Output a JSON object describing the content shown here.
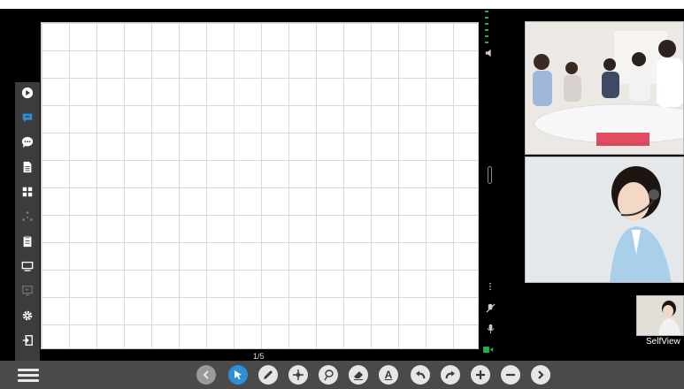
{
  "whiteboard": {
    "page_indicator": "1/5"
  },
  "left_toolbar": {
    "items": [
      {
        "icon": "play-circle-icon"
      },
      {
        "icon": "chat-bubble-icon",
        "active": true
      },
      {
        "icon": "message-dots-icon"
      },
      {
        "icon": "document-icon"
      },
      {
        "icon": "grid-icon"
      },
      {
        "icon": "share-nodes-icon"
      },
      {
        "icon": "clipboard-icon"
      },
      {
        "icon": "monitor-icon"
      },
      {
        "icon": "screen-share-icon"
      },
      {
        "icon": "settings-gear-icon"
      },
      {
        "icon": "exit-icon"
      }
    ]
  },
  "video_panel": {
    "self_view_label": "SelfView"
  },
  "bottom_toolbar": {
    "tools": [
      {
        "name": "previous-page",
        "icon": "chevron-left-icon",
        "disabled": true
      },
      {
        "name": "select",
        "icon": "cursor-arrow-icon",
        "active": true
      },
      {
        "name": "pen",
        "icon": "pen-icon"
      },
      {
        "name": "move",
        "icon": "move-crosshair-icon"
      },
      {
        "name": "lasso",
        "icon": "lasso-icon"
      },
      {
        "name": "eraser",
        "icon": "eraser-icon"
      },
      {
        "name": "text",
        "icon": "text-icon",
        "text": "A"
      },
      {
        "name": "undo",
        "icon": "undo-icon"
      },
      {
        "name": "redo",
        "icon": "redo-icon"
      },
      {
        "name": "zoom-in",
        "icon": "plus-icon"
      },
      {
        "name": "zoom-out",
        "icon": "minus-icon"
      },
      {
        "name": "next-page",
        "icon": "chevron-right-icon"
      }
    ]
  },
  "colors": {
    "accent": "#2f8fd6",
    "signal": "#1fb54e",
    "toolbar_bg": "#4a4a4a",
    "rail_bg": "#3c3c3c"
  }
}
